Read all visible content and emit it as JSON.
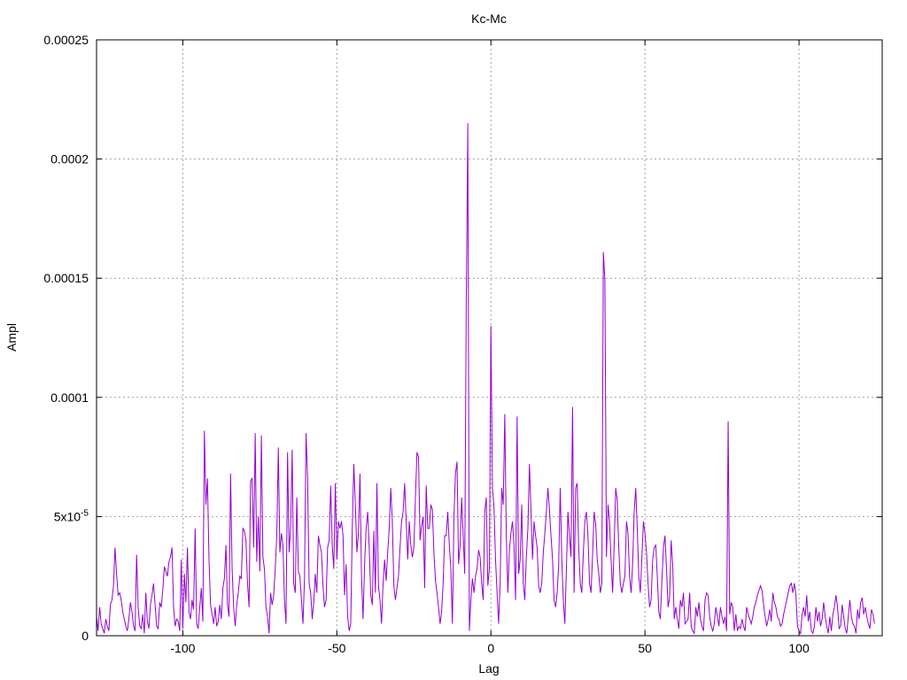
{
  "chart_data": {
    "type": "line",
    "title": "Kc-Mc",
    "xlabel": "Lag",
    "ylabel": "Ampl",
    "xlim": [
      -128,
      127
    ],
    "ylim": [
      0,
      0.00025
    ],
    "grid": true,
    "line_color": "#9400d3",
    "x_ticks": [
      {
        "value": -100,
        "label": "-100"
      },
      {
        "value": -50,
        "label": "-50"
      },
      {
        "value": 0,
        "label": "0"
      },
      {
        "value": 50,
        "label": "50"
      },
      {
        "value": 100,
        "label": "100"
      }
    ],
    "y_ticks": [
      {
        "value": 0,
        "label": "0"
      },
      {
        "value": 5e-05,
        "label": "5x10",
        "sup": "-5"
      },
      {
        "value": 0.0001,
        "label": "0.0001"
      },
      {
        "value": 0.00015,
        "label": "0.00015"
      },
      {
        "value": 0.0002,
        "label": "0.0002"
      },
      {
        "value": 0.00025,
        "label": "0.00025"
      }
    ],
    "series": [
      {
        "x_start": -128,
        "x_step": 0.5,
        "values": [
          8e-06,
          2e-06,
          1.2e-05,
          5e-06,
          3e-06,
          1e-06,
          7e-06,
          4e-06,
          2e-06,
          1.3e-05,
          1.5e-05,
          2.1e-05,
          3.7e-05,
          2.6e-05,
          1.7e-05,
          1.8e-05,
          1.5e-05,
          1e-05,
          7e-06,
          4e-06,
          2e-06,
          7e-06,
          1.4e-05,
          1e-05,
          4e-06,
          2e-06,
          3.4e-05,
          1.2e-05,
          4e-06,
          3e-06,
          9e-06,
          1e-06,
          1.8e-05,
          6e-06,
          3e-06,
          1.3e-05,
          1.7e-05,
          2.2e-05,
          1.3e-05,
          4e-06,
          3e-06,
          1.4e-05,
          1.2e-05,
          1.9e-05,
          2.9e-05,
          2.7e-05,
          2.5e-05,
          3.1e-05,
          3.3e-05,
          3.7e-05,
          1.2e-05,
          4e-06,
          7e-06,
          6e-06,
          2e-06,
          3.2e-05,
          3e-06,
          2.6e-05,
          1.4e-05,
          3.7e-05,
          1e-05,
          7e-06,
          1.5e-05,
          1.1e-05,
          4.5e-05,
          5e-06,
          3e-06,
          1.2e-05,
          2e-05,
          6e-06,
          8.6e-05,
          5.5e-05,
          6.6e-05,
          3.2e-05,
          1.3e-05,
          9e-06,
          5e-06,
          1.2e-05,
          4e-06,
          6e-06,
          1.3e-05,
          7e-06,
          2e-05,
          2.4e-05,
          3.8e-05,
          1.3e-05,
          8e-06,
          6.8e-05,
          2.8e-05,
          1.2e-05,
          4e-06,
          1.3e-05,
          1.8e-05,
          2.5e-05,
          2.4e-05,
          4.5e-05,
          4.4e-05,
          4e-05,
          2.2e-05,
          1.2e-05,
          6.5e-05,
          6.6e-05,
          3.7e-05,
          8.5e-05,
          3.1e-05,
          5e-05,
          2.7e-05,
          8.4e-05,
          3.3e-05,
          2.8e-05,
          1.2e-05,
          8e-06,
          1e-06,
          1.8e-05,
          1.3e-05,
          1.7e-05,
          2.8e-05,
          4.2e-05,
          7.9e-05,
          3.5e-05,
          4.3e-05,
          3.8e-05,
          1.5e-05,
          5e-06,
          7.7e-05,
          3.5e-05,
          4.5e-05,
          7.8e-05,
          2.2e-05,
          1.8e-05,
          5.8e-05,
          2.7e-05,
          2.5e-05,
          1.5e-05,
          5e-06,
          2.4e-05,
          8.5e-05,
          6.6e-05,
          2.2e-05,
          1.8e-05,
          7e-06,
          1.4e-05,
          2.6e-05,
          1.8e-05,
          4.2e-05,
          3.8e-05,
          3.5e-05,
          2.1e-05,
          1.2e-05,
          1.5e-05,
          3.7e-05,
          4e-05,
          6.3e-05,
          3.8e-05,
          2.8e-05,
          6.4e-05,
          3.2e-05,
          4.8e-05,
          4.5e-05,
          4.8e-05,
          4.2e-05,
          1.7e-05,
          3e-05,
          8e-06,
          2e-06,
          5e-06,
          4.5e-05,
          7.2e-05,
          5.5e-05,
          3.5e-05,
          4.3e-05,
          6.8e-05,
          2.5e-05,
          7e-06,
          3e-05,
          4.5e-05,
          5.2e-05,
          3.7e-05,
          1.7e-05,
          1.3e-05,
          4.4e-05,
          1.8e-05,
          6.4e-05,
          2.1e-05,
          1.5e-05,
          5e-06,
          2.2e-05,
          3.2e-05,
          2.3e-05,
          3.5e-05,
          4.5e-05,
          6.2e-05,
          4.8e-05,
          2.1e-05,
          1.5e-05,
          2e-05,
          2.5e-05,
          3.7e-05,
          4.8e-05,
          5.2e-05,
          6.4e-05,
          4.8e-05,
          3.2e-05,
          4.8e-05,
          3.8e-05,
          3.3e-05,
          3.7e-05,
          5.8e-05,
          7.7e-05,
          7.5e-05,
          4e-05,
          4.6e-05,
          5e-05,
          2e-05,
          6.3e-05,
          4.5e-05,
          4.5e-05,
          5.5e-05,
          5.3e-05,
          3.5e-05,
          2.3e-05,
          1.8e-05,
          1.2e-05,
          5e-06,
          1e-05,
          2.2e-05,
          4.2e-05,
          4.2e-05,
          5.2e-05,
          3.8e-05,
          2.8e-05,
          5e-06,
          5e-05,
          6.8e-05,
          7.3e-05,
          3e-05,
          3.8e-05,
          5.8e-05,
          4.2e-05,
          2.6e-05,
          1.8e-05,
          1.2e-05,
          2e-06,
          1.5e-05,
          2.4e-05,
          1.8e-05,
          2.5e-05,
          2.8e-05,
          3.6e-05,
          3.3e-05,
          2.2e-05,
          1.5e-05,
          5.2e-05,
          5.8e-05,
          2.1e-05,
          2.8e-05,
          5.8e-05,
          6.2e-05,
          5.4e-05,
          3.2e-05,
          1.8e-05,
          5e-06,
          2.2e-05,
          6.2e-05,
          5.5e-05,
          5.2e-05,
          4.2e-05,
          1.8e-05,
          3.6e-05,
          4.3e-05,
          4.8e-05,
          3.8e-05,
          1.5e-05,
          1.2e-05,
          2.6e-05,
          3.2e-05,
          5.5e-05,
          2.2e-05,
          1.5e-05,
          3.3e-05,
          4.5e-05,
          7.2e-05,
          5.3e-05,
          3.2e-05,
          4.8e-05,
          4.2e-05,
          3.7e-05,
          2.1e-05,
          1.8e-05,
          2.2e-05,
          3.5e-05,
          4.3e-05,
          5.2e-05,
          6.2e-05,
          5.3e-05,
          4.2e-05,
          3.2e-05,
          1.5e-05,
          1.2e-05,
          1.8e-05,
          3e-05,
          6.2e-05,
          3.2e-05,
          1.5e-05,
          5e-06,
          2.8e-05,
          5.2e-05,
          4.2e-05,
          3.3e-05,
          2.6e-05,
          1.8e-05,
          6.2e-05,
          6.4e-05,
          3.7e-05,
          2.2e-05,
          1.8e-05,
          3.5e-05,
          4.8e-05,
          5.2e-05,
          4.2e-05,
          2.2e-05,
          1.8e-05,
          3.4e-05,
          5.2e-05,
          4.7e-05,
          3.2e-05,
          2.6e-05,
          1.8e-05,
          2.2e-05,
          3.2e-05,
          3.8e-05,
          3.3e-05,
          5.5e-05,
          4.8e-05,
          3.2e-05,
          1.8e-05,
          3.8e-05,
          6.2e-05,
          5.7e-05,
          3.7e-05,
          2.2e-05,
          1.8e-05,
          2.2e-05,
          2.5e-05,
          4.8e-05,
          4.3e-05,
          2.5e-05,
          1.8e-05,
          3e-05,
          5.2e-05,
          6.2e-05,
          4.5e-05,
          2.5e-05,
          1.8e-05,
          3.3e-05,
          4.8e-05,
          4.3e-05,
          3.5e-05,
          2.2e-05,
          1.2e-05,
          1.5e-05,
          3.2e-05,
          3.7e-05,
          3.8e-05,
          2.5e-05,
          1e-05,
          7e-06,
          2.3e-05,
          3.7e-05,
          4.2e-05,
          2.8e-05,
          1.2e-05,
          1.6e-05,
          4e-05,
          3e-05,
          7e-06,
          1.2e-05,
          7e-06,
          3e-06,
          1.5e-05,
          1.2e-05,
          1.8e-05,
          5e-06,
          6e-06,
          7e-06,
          1.8e-05,
          4e-06,
          2e-06,
          1e-06,
          1.2e-05,
          8e-06,
          1.4e-05,
          7e-06,
          4e-06,
          2e-06,
          1.5e-05,
          1.8e-05,
          1.7e-05,
          8e-06,
          4e-06,
          2e-06,
          5e-06,
          1.2e-05,
          8e-06,
          4e-06,
          1.2e-05,
          8e-06,
          5e-06,
          8e-06,
          2e-06,
          1e-06,
          9e-06,
          1.4e-05,
          1.2e-05,
          2e-06,
          9e-06,
          2e-06,
          4e-06,
          3e-06,
          7e-06,
          4e-06,
          2e-06,
          1.2e-05,
          9e-06,
          7e-06,
          5e-06,
          8e-06,
          1.2e-05,
          1.4e-05,
          1.7e-05,
          1.9e-05,
          2.1e-05,
          1.9e-05,
          1.3e-05,
          8e-06,
          4e-06,
          7e-06,
          1.1e-05,
          6e-06,
          1.8e-05,
          1.4e-05,
          1.2e-05,
          8e-06,
          7e-06,
          4e-06,
          5e-06,
          9e-06,
          1.2e-05,
          1.5e-05,
          1.8e-05,
          2.1e-05,
          2.2e-05,
          1.8e-05,
          2.2e-05,
          1.7e-05,
          4e-06,
          2e-06,
          1e-06,
          9e-06,
          1.2e-05,
          8e-06,
          1.7e-05,
          6e-06,
          1e-05,
          2e-06,
          1e-06,
          4e-06,
          1.2e-05,
          6e-06,
          1e-05,
          4e-06,
          7e-06,
          1.4e-05,
          8e-06,
          4e-06,
          1e-06,
          8e-06,
          2e-06,
          9e-06,
          1.2e-05,
          1.7e-05,
          1.2e-05,
          3e-06,
          4e-06,
          1.3e-05,
          8e-06,
          3e-06,
          1e-06,
          8e-06,
          1.5e-05,
          8e-06,
          5e-06,
          4e-06,
          1e-06,
          1.1e-05,
          7e-06,
          1.4e-05,
          1.6e-05,
          9e-06,
          1.2e-05,
          8e-06,
          5e-06,
          3e-06,
          1.1e-05,
          9e-06,
          5e-06
        ]
      },
      {
        "peaks": [
          {
            "x": -7.5,
            "y": 0.000215
          },
          {
            "x": -8,
            "y": 0.00014
          },
          {
            "x": 0,
            "y": 0.00013
          },
          {
            "x": 36.5,
            "y": 0.000161
          },
          {
            "x": 37,
            "y": 0.000149
          },
          {
            "x": 4.5,
            "y": 9.3e-05
          },
          {
            "x": 8.5,
            "y": 9.2e-05
          },
          {
            "x": 26.5,
            "y": 9.6e-05
          },
          {
            "x": 77,
            "y": 9e-05
          }
        ]
      }
    ]
  }
}
